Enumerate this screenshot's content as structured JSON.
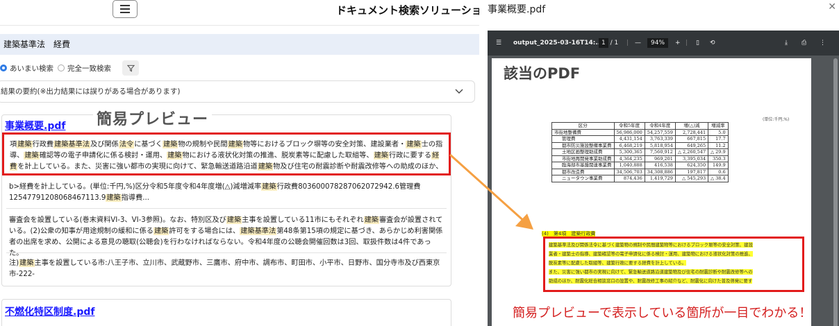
{
  "header": {
    "title": "ドキュメント検索ソリューション"
  },
  "search": {
    "query": "建築基準法　経費"
  },
  "modes": [
    {
      "label": "あいまい検索",
      "selected": true
    },
    {
      "label": "完全一致検索",
      "selected": false
    }
  ],
  "summary": {
    "label": "結果の要約(※出力結果には誤りがある場合があります)"
  },
  "results": [
    {
      "file": "事業概要.pdf",
      "preview_label": "簡易プレビュー",
      "highlight_snippet": "項 建築 行政費 建築基準法 及び関係 法令 に基づく 建築 物の規制や民間 建築 物等におけるブロック塀等の安全対策、建設業者・ 建築 士の指導、 建築 確認等の電子申請化に係る検討・運用、 建築 物における液状化対策の推進、脱炭素等に配慮した取組等、 建築 行政に要する 経費 を計上している。また、災害に強い都市の実現に向けて、緊急輸送道路沿道 建築 物及び住宅の耐震診断や耐震改修等への助成のほか、耐震化総合相談...",
      "snippets": [
        "b>経費を計上している。(単位:千円,%)区分令和5年度令和4年度増(△)減増減率 建築 行政費80360007828706207294​2.6管理費 12547791208068467113.9 建築 指導費...",
        "審査会を設置している(巻末資料VI-3、VI-3参照)。なお、特別区及び 建築 主事を設置している11市にもそれぞれ 建築 審査会が設置されている。(2) 公衆の知事が用途規制の緩和に係る 建築 許可をする場合には、 建築基準法 第48条第15項の規定に基づき、あらかじめ利害関係者の出席を求め、公開による意見の聴取(公聴会)を行わなければならない。令和4年度の公聴会開催回数は3回、取扱件数は4件であった。",
        "注) 建築 主事を設置している市:八王子市、立川市、武蔵野市、三鷹市、府中市、調布市、町田市、小平市、日野市、国分寺市及び西東京市-222-"
      ]
    },
    {
      "file": "不燃化特区制度.pdf"
    }
  ],
  "viewer": {
    "title": "事業概要.pdf",
    "filename": "output_2025-03-16T14:...",
    "page_current": "1",
    "page_total": "/ 1",
    "zoom": "94%",
    "page_heading": "該当のPDF",
    "unit_note": "(単位:千円,%)",
    "table": {
      "headers": [
        "区分",
        "令和5年度",
        "令和4年度",
        "増(△)減",
        "増減率"
      ],
      "rows": [
        [
          "市街地整備費",
          "56,986,000",
          "54,257,559",
          "2,728,441",
          "5.0"
        ],
        [
          "管理費",
          "4,431,154",
          "3,763,339",
          "667,815",
          "17.7"
        ],
        [
          "都市防災施設整備事業費",
          "6,468,219",
          "5,818,954",
          "649,265",
          "11.2"
        ],
        [
          "土地区画整理助成費",
          "5,300,365",
          "7,560,912",
          "△ 2,260,547",
          "△ 29.9"
        ],
        [
          "市街地再開発事業助成費",
          "4,364,235",
          "969,201",
          "3,395,034",
          "350.3"
        ],
        [
          "臨海部市基盤関連事業費",
          "1,040,888",
          "416,538",
          "624,350",
          "149.9"
        ],
        [
          "都市改造費",
          "34,506,703",
          "34,308,886",
          "197,817",
          "0.6"
        ],
        [
          "ニュータウン事業費",
          "874,436",
          "1,419,729",
          "△ 545,293",
          "△ 38.4"
        ]
      ]
    },
    "section_heading": "(4)　第4項　建築行政費",
    "highlighted_lines": [
      "建築基準法及び関係法令に基づく建築物の規制や民間建築物等におけるブロック塀等の安全対策、建設",
      "業者・建築士の指導、建築確認等の電子申請化に係る検討・運用、建築物における液状化対策の推進、",
      "脱炭素等に配慮した取組等、建築行政に要する経費を計上している。",
      "また、災害に強い都市の実現に向けて、緊急輸送道路沿道建築物及び住宅の耐震診断や耐震改修等への",
      "助成のほか、耐震化総合相談窓口の設置や、耐震改修工事の紹介など、耐震化に向けた普及啓発に要す"
    ],
    "annotation": "簡易プレビューで表示している箇所が一目でわかる！"
  },
  "colors": {
    "highlight_border": "#e21b1b",
    "arrow": "#f5a043",
    "link": "#1a1aff",
    "keyword_bg": "#fbeec1"
  },
  "icons": [
    "hamburger-icon",
    "filter-icon",
    "chevron-down-icon",
    "close-icon",
    "pdf-menu-icon",
    "download-icon",
    "print-icon",
    "more-icon",
    "fit-page-icon",
    "rotate-icon"
  ]
}
